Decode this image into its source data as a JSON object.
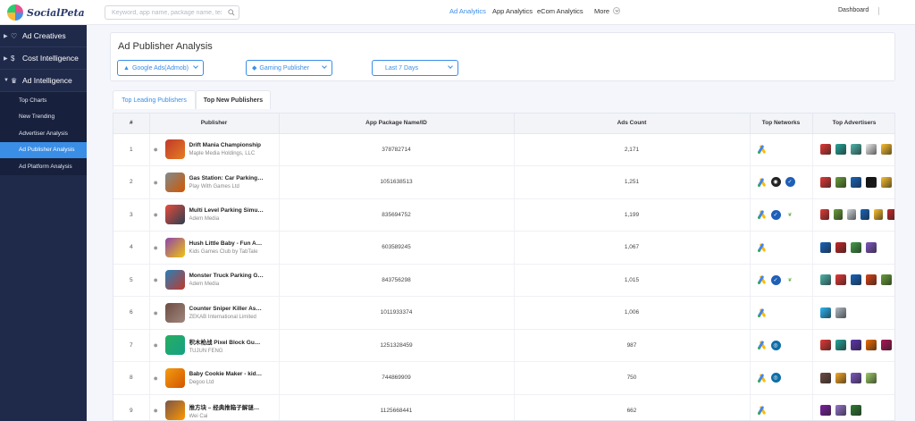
{
  "brand": "SocialPeta",
  "search": {
    "placeholder": "Keyword, app name, package name, text"
  },
  "topnav": [
    "Ad Analytics",
    "App Analytics",
    "eCom Analytics",
    "More"
  ],
  "dashboard": "Dashboard",
  "sidebar": {
    "sections": [
      "Ad Creatives",
      "Cost Intelligence",
      "Ad Intelligence"
    ],
    "sub_items": [
      "Top Charts",
      "New Trending",
      "Advertiser Analysis",
      "Ad Publisher Analysis",
      "Ad Platform Analysis"
    ]
  },
  "page_title": "Ad Publisher Analysis",
  "filters": {
    "network": "Google Ads(Admob)",
    "category": "Gaming Publisher",
    "period": "Last 7 Days"
  },
  "tabs": [
    "Top Leading Publishers",
    "Top New Publishers"
  ],
  "table": {
    "headers": [
      "#",
      "Publisher",
      "App Package Name/ID",
      "Ads Count",
      "Top Networks",
      "Top Advertisers"
    ],
    "rows": [
      {
        "rank": "1",
        "app": "Drift Mania Championship",
        "dev": "Maple Media Holdings, LLC",
        "pkg": "378782714",
        "ads": "2,171"
      },
      {
        "rank": "2",
        "app": "Gas Station: Car Parking…",
        "dev": "Play With Games Ltd",
        "pkg": "1051638513",
        "ads": "1,251"
      },
      {
        "rank": "3",
        "app": "Multi Level Parking Simu…",
        "dev": "Adem Media",
        "pkg": "835694752",
        "ads": "1,199"
      },
      {
        "rank": "4",
        "app": "Hush Little Baby - Fun A…",
        "dev": "Kids Games Club by TabTale",
        "pkg": "603589245",
        "ads": "1,067"
      },
      {
        "rank": "5",
        "app": "Monster Truck Parking G…",
        "dev": "Adem Media",
        "pkg": "843756298",
        "ads": "1,015"
      },
      {
        "rank": "6",
        "app": "Counter Sniper Killer As…",
        "dev": "ZEKAB International Limited",
        "pkg": "1011933374",
        "ads": "1,006"
      },
      {
        "rank": "7",
        "app": "积木枪战 Pixel Block Gu…",
        "dev": "TUJUN FENG",
        "pkg": "1251328459",
        "ads": "987"
      },
      {
        "rank": "8",
        "app": "Baby Cookie Maker - kid…",
        "dev": "Degoo Ltd",
        "pkg": "744869909",
        "ads": "750"
      },
      {
        "rank": "9",
        "app": "推方块 – 经典推箱子解谜…",
        "dev": "Wei Cai",
        "pkg": "1125668441",
        "ads": "662"
      }
    ]
  },
  "colors": {
    "accent": "#3a8ee6",
    "sidebar": "#1f2a4b"
  }
}
